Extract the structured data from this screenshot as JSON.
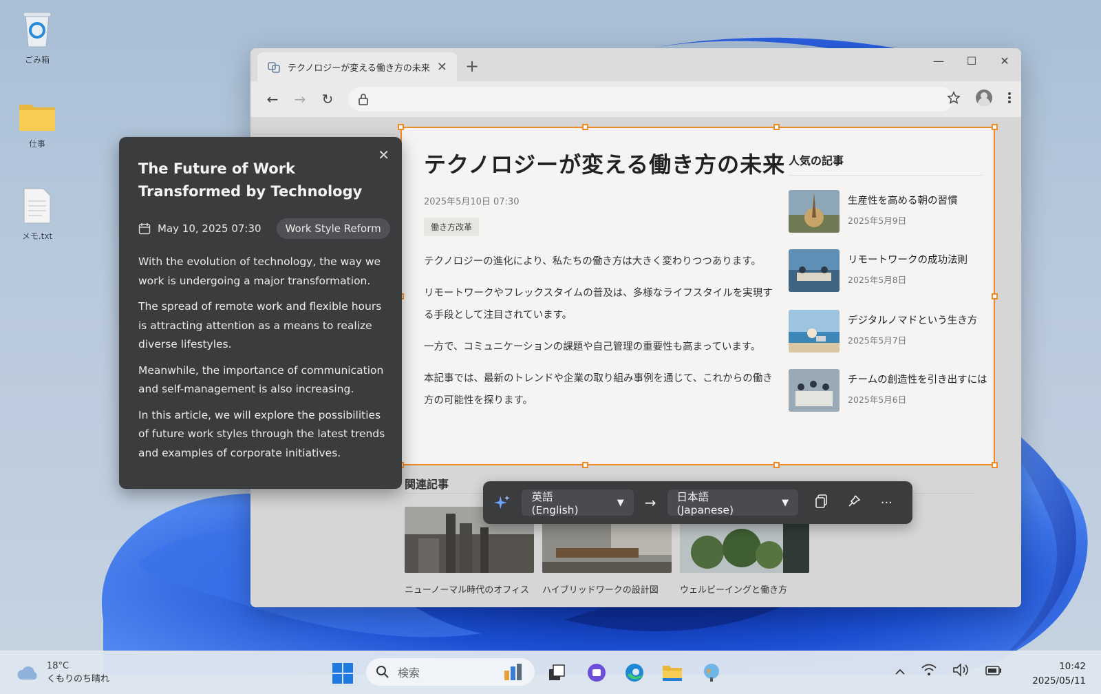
{
  "desktop": {
    "icons": [
      {
        "label": "ごみ箱",
        "icon": "recycle-bin-icon"
      },
      {
        "label": "仕事",
        "icon": "folder-icon"
      },
      {
        "label": "メモ.txt",
        "icon": "text-file-icon"
      }
    ]
  },
  "browser": {
    "tab_title": "テクノロジーが変える働き方の未来",
    "tab_close": "✕",
    "new_tab": "+",
    "window_controls": [
      "—",
      "☐",
      "✕"
    ],
    "nav": {
      "back": "←",
      "forward": "→",
      "reload": "↻"
    }
  },
  "article": {
    "title": "テクノロジーが変える働き方の未来",
    "date": "2025年5月10日 07:30",
    "tag": "働き方改革",
    "paragraphs": [
      "テクノロジーの進化により、私たちの働き方は大きく変わりつつあります。",
      "リモートワークやフレックスタイムの普及は、多様なライフスタイルを実現する手段として注目されています。",
      "一方で、コミュニケーションの課題や自己管理の重要性も高まっています。",
      "本記事では、最新のトレンドや企業の取り組み事例を通じて、これからの働き方の可能性を探ります。"
    ]
  },
  "popular": {
    "heading": "人気の記事",
    "items": [
      {
        "title": "生産性を高める朝の習慣",
        "date": "2025年5月9日"
      },
      {
        "title": "リモートワークの成功法則",
        "date": "2025年5月8日"
      },
      {
        "title": "デジタルノマドという生き方",
        "date": "2025年5月7日"
      },
      {
        "title": "チームの創造性を引き出すには",
        "date": "2025年5月6日"
      }
    ]
  },
  "related": {
    "heading": "関連記事",
    "items": [
      {
        "title": "ニューノーマル時代のオフィス"
      },
      {
        "title": "ハイブリッドワークの設計図"
      },
      {
        "title": "ウェルビーイングと働き方"
      }
    ]
  },
  "translation_panel": {
    "title": "The Future of Work Transformed by Technology",
    "date": "May 10, 2025 07:30",
    "tag": "Work Style Reform",
    "paragraphs": [
      "With the evolution of technology, the way we work is undergoing a major transformation.",
      "The spread of remote work and flexible hours is attracting attention as a means to realize diverse lifestyles.",
      "Meanwhile, the importance of communication and self-management is also increasing.",
      "In this article, we will explore the possibilities of future work styles through the latest trends and examples of corporate initiatives."
    ],
    "close": "✕"
  },
  "translate_toolbar": {
    "source_lang": "英語 (English)",
    "target_lang": "日本語 (Japanese)",
    "arrow": "→",
    "more": "···"
  },
  "taskbar": {
    "weather_temp": "18°C",
    "weather_desc": "くもりのち晴れ",
    "search_placeholder": "検索",
    "time": "10:42",
    "date": "2025/05/11"
  },
  "colors": {
    "selection": "#f08a24",
    "panel_bg": "#3b3c3e",
    "bloom": "#1f56d6"
  }
}
